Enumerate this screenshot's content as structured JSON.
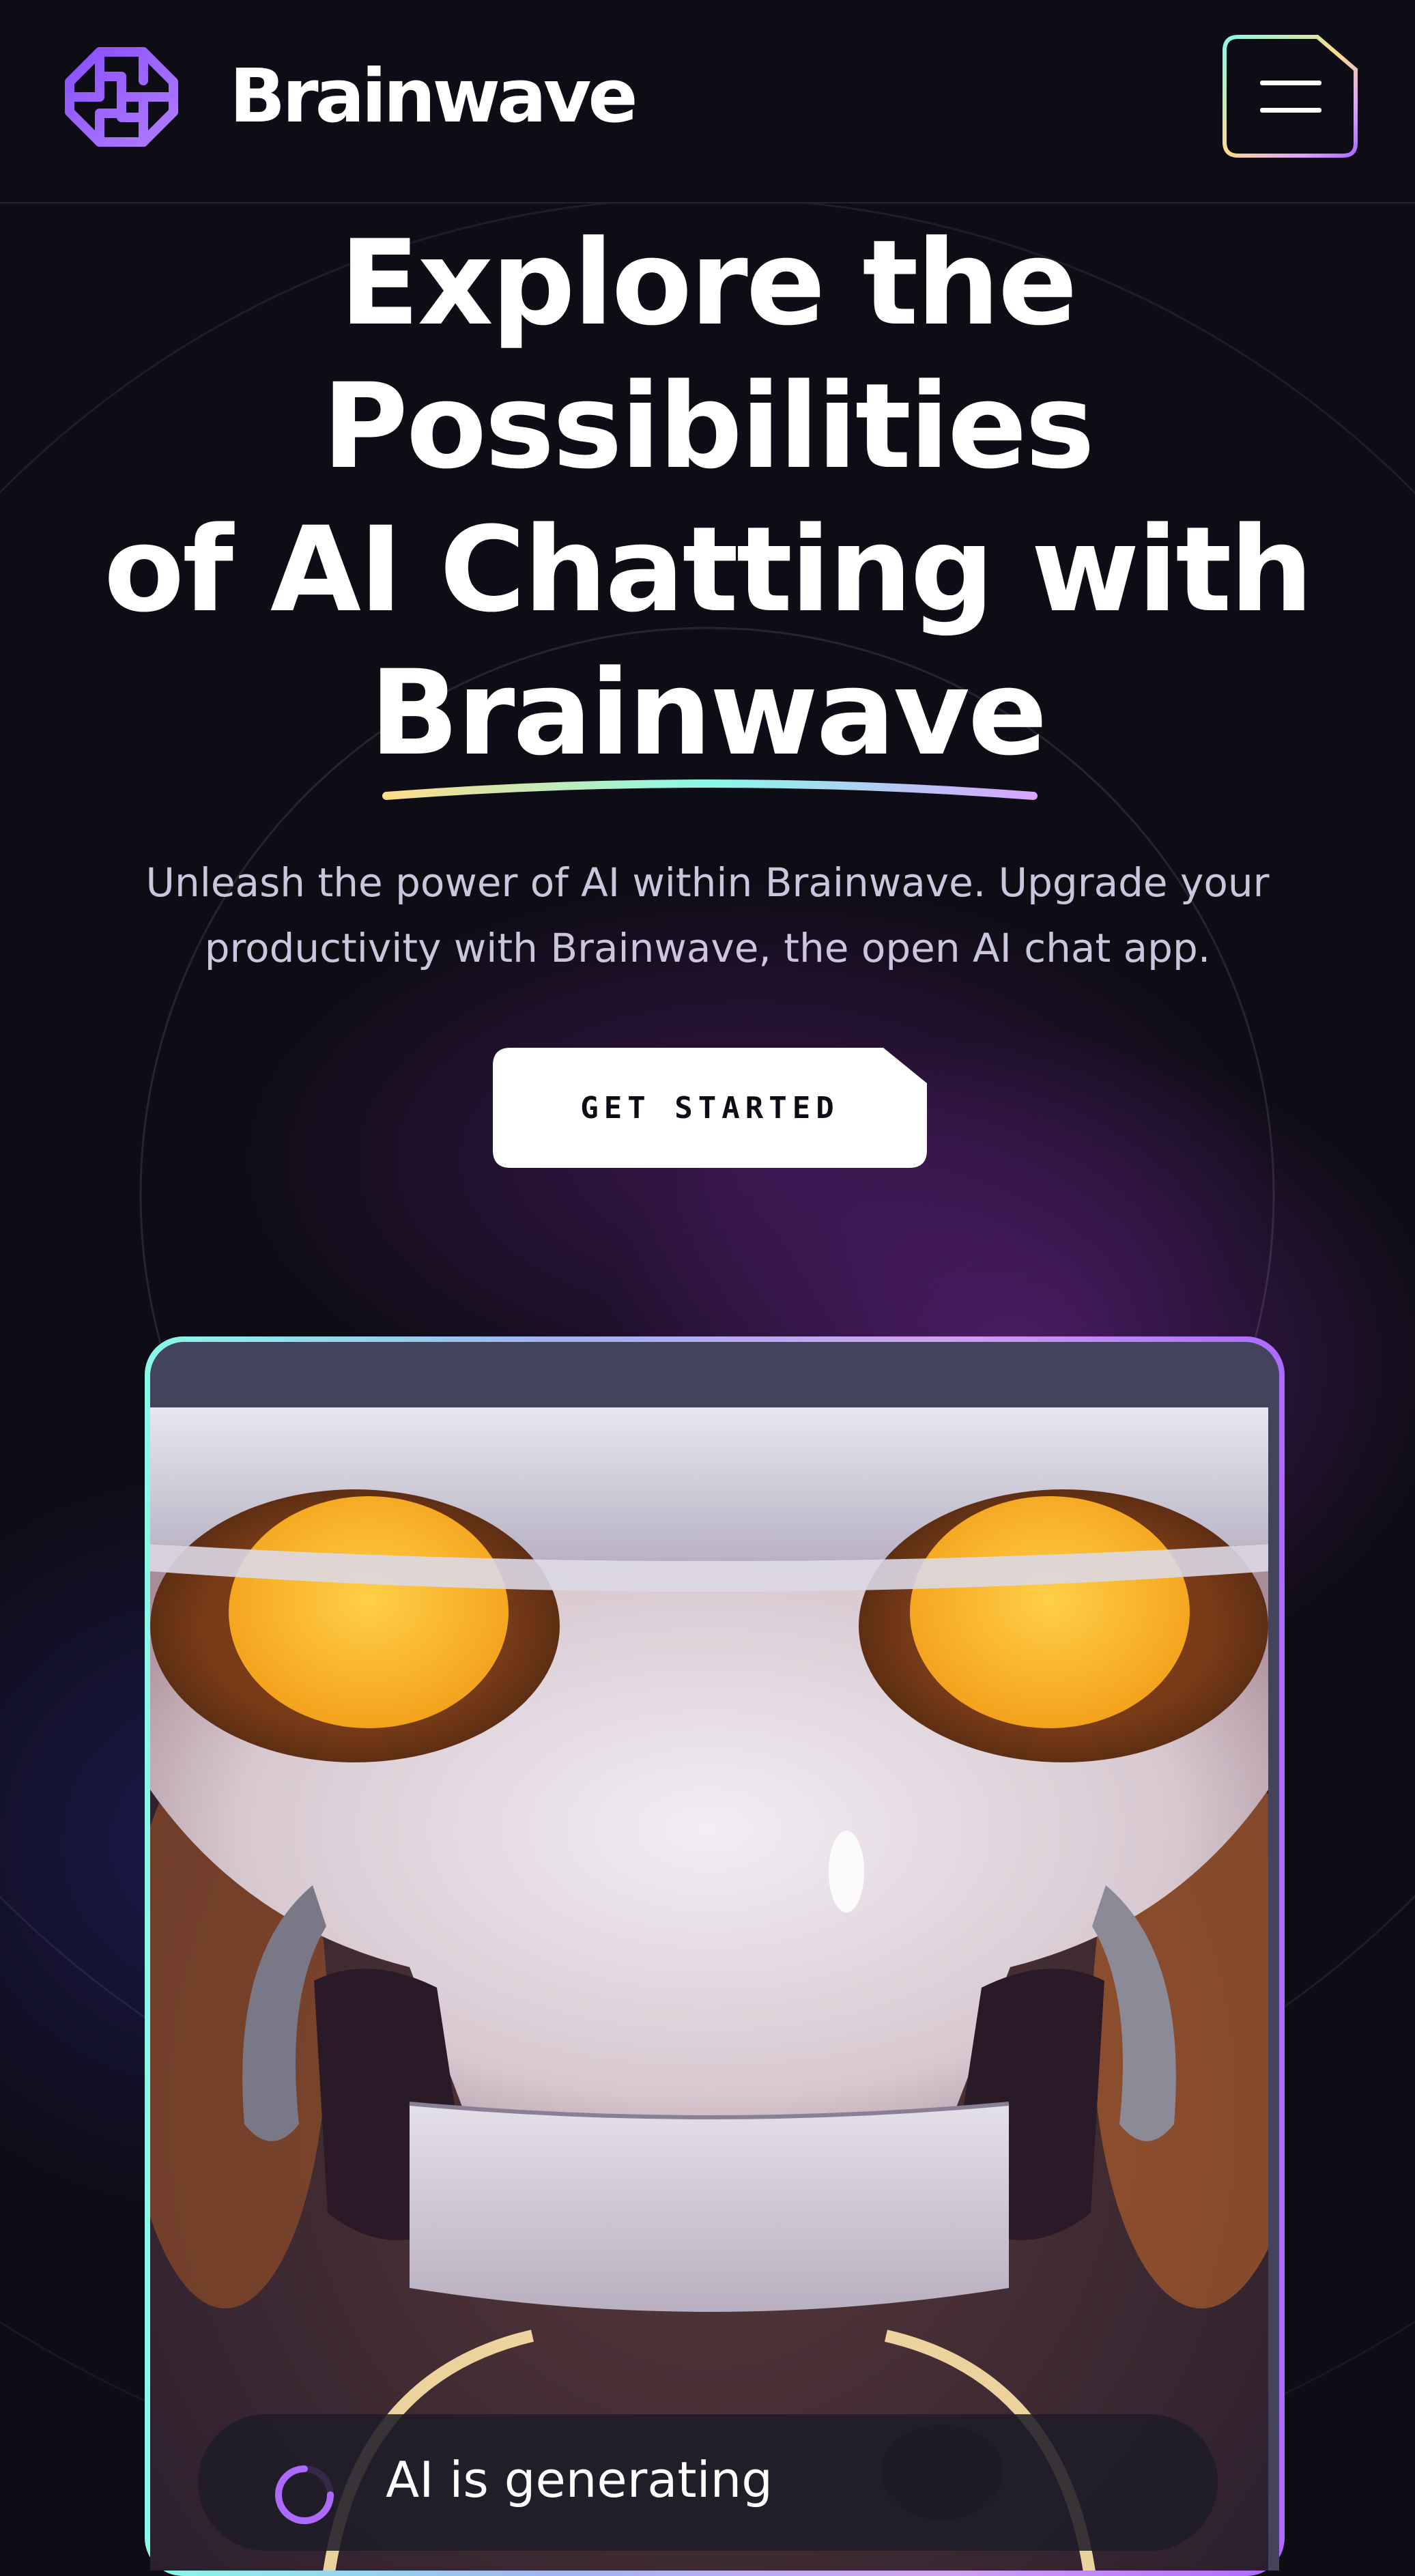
{
  "header": {
    "brand": "Brainwave",
    "logo_icon": "brainwave-logo-icon",
    "menu_icon": "hamburger-menu-icon"
  },
  "hero": {
    "title_lines": [
      "Explore the",
      "Possibilities",
      "of AI Chatting with",
      "Brainwave"
    ],
    "subtitle_lines": [
      "Unleash the power of AI within Brainwave. Upgrade your",
      "productivity with Brainwave, the open AI chat app."
    ],
    "cta_label": "GET STARTED"
  },
  "preview": {
    "status_text": "AI is generating",
    "spinner_icon": "loading-spinner-icon"
  },
  "colors": {
    "background": "#0e0c15",
    "accent_purple": "#ac6aff",
    "accent_teal": "#89f9e8",
    "accent_yellow": "#fddc8a"
  }
}
